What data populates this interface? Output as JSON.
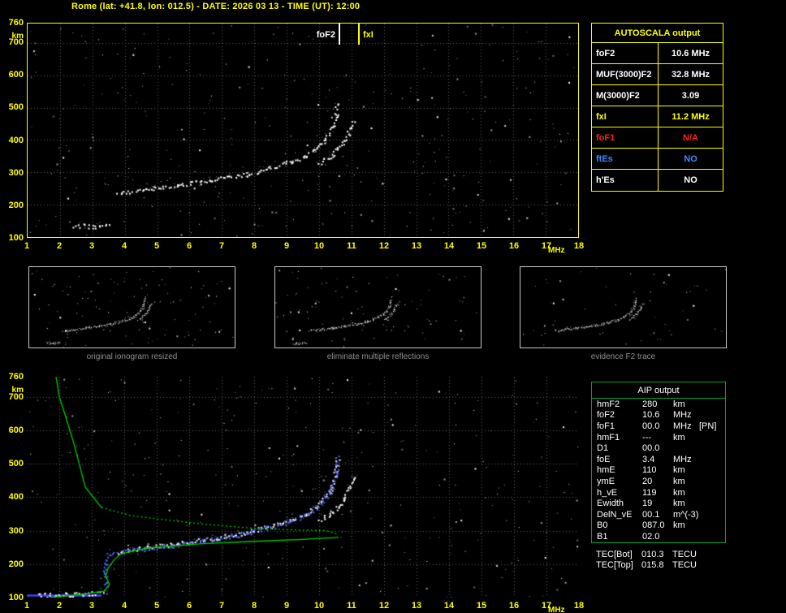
{
  "title": "Rome (lat: +41.8, lon: 012.5) - DATE: 2026 03 13 - TIME (UT): 12:00",
  "colors": {
    "accent_yellow": "#ffff00",
    "status_red": "#ff2222",
    "status_blue": "#3d8bff",
    "profile_green": "#00cc00",
    "restored_blue": "#5066ff"
  },
  "autoscala_table": {
    "title": "AUTOSCALA output",
    "rows": [
      {
        "label": "foF2",
        "value": "10.6 MHz",
        "color": "#ffffff"
      },
      {
        "label": "MUF(3000)F2",
        "value": "32.8 MHz",
        "color": "#ffffff"
      },
      {
        "label": "M(3000)F2",
        "value": "3.09",
        "color": "#ffffff"
      },
      {
        "label": "fxI",
        "value": "11.2 MHz",
        "color": "#ffff00"
      },
      {
        "label": "foF1",
        "value": "N/A",
        "color": "#ff2222"
      },
      {
        "label": "ftEs",
        "value": "NO",
        "color": "#3d8bff"
      },
      {
        "label": "h'Es",
        "value": "NO",
        "color": "#ffffff"
      }
    ]
  },
  "thumbnails": [
    {
      "caption": "original ionogram resized"
    },
    {
      "caption": "eliminate multiple reflections"
    },
    {
      "caption": "evidence F2 trace"
    }
  ],
  "aip_table": {
    "title": "AIP output",
    "rows": [
      {
        "label": "hmF2",
        "value": "280",
        "unit": "km",
        "note": ""
      },
      {
        "label": "foF2",
        "value": "10.6",
        "unit": "MHz",
        "note": ""
      },
      {
        "label": "foF1",
        "value": "00.0",
        "unit": "MHz",
        "note": "[PN]"
      },
      {
        "label": "hmF1",
        "value": "---",
        "unit": "km",
        "note": ""
      },
      {
        "label": "D1",
        "value": "00.0",
        "unit": "",
        "note": ""
      },
      {
        "label": "foE",
        "value": "3.4",
        "unit": "MHz",
        "note": ""
      },
      {
        "label": "hmE",
        "value": "110",
        "unit": "km",
        "note": ""
      },
      {
        "label": "ymE",
        "value": "20",
        "unit": "km",
        "note": ""
      },
      {
        "label": "h_vE",
        "value": "119",
        "unit": "km",
        "note": ""
      },
      {
        "label": "Ewidth",
        "value": "19",
        "unit": "km",
        "note": ""
      },
      {
        "label": "DelN_vE",
        "value": "00.1",
        "unit": "m^(-3)",
        "note": ""
      },
      {
        "label": "B0",
        "value": "087.0",
        "unit": "km",
        "note": ""
      },
      {
        "label": "B1",
        "value": "02.0",
        "unit": "",
        "note": ""
      }
    ],
    "extra_rows": [
      {
        "label": "TEC[Bot]",
        "value": "010.3",
        "unit": "TECU"
      },
      {
        "label": "TEC[Top]",
        "value": "015.8",
        "unit": "TECU"
      }
    ]
  },
  "chart_data": [
    {
      "id": "main_ionogram",
      "type": "scatter",
      "title": "scaled ionogram",
      "xlabel": "frequency",
      "x_unit": "MHz",
      "ylabel": "virtual height",
      "y_unit": "km",
      "xlim": [
        1,
        18
      ],
      "ylim": [
        100,
        760
      ],
      "x_ticks": [
        1,
        2,
        3,
        4,
        5,
        6,
        7,
        8,
        9,
        10,
        11,
        12,
        13,
        14,
        15,
        16,
        17,
        18
      ],
      "y_ticks": [
        760,
        700,
        600,
        500,
        400,
        300,
        200,
        100
      ],
      "grid": true,
      "markers": [
        {
          "label": "foF2",
          "x": 10.6,
          "color": "#ffffff",
          "side": "left"
        },
        {
          "label": "fxI",
          "x": 11.2,
          "color": "#ffff00",
          "side": "right"
        }
      ],
      "series": [
        {
          "name": "e-layer-trace",
          "color": "#ffffff",
          "style": "dots",
          "points": [
            [
              2.45,
              138
            ],
            [
              3.0,
              134
            ],
            [
              3.5,
              140
            ]
          ]
        },
        {
          "name": "f2-ordinary-trace",
          "color": "#ffffff",
          "style": "dots",
          "points": [
            [
              3.8,
              237
            ],
            [
              4.7,
              250
            ],
            [
              5.7,
              262
            ],
            [
              6.7,
              277
            ],
            [
              7.7,
              294
            ],
            [
              8.4,
              312
            ],
            [
              9.1,
              332
            ],
            [
              9.6,
              352
            ],
            [
              9.9,
              374
            ],
            [
              10.2,
              402
            ],
            [
              10.4,
              436
            ],
            [
              10.5,
              474
            ],
            [
              10.55,
              512
            ]
          ]
        },
        {
          "name": "f2-extraordinary-trace",
          "color": "#ffffff",
          "style": "dots",
          "points": [
            [
              10.0,
              330
            ],
            [
              10.3,
              350
            ],
            [
              10.6,
              375
            ],
            [
              10.8,
              405
            ],
            [
              10.95,
              435
            ],
            [
              11.05,
              462
            ]
          ]
        }
      ]
    },
    {
      "id": "profile_ionogram",
      "type": "scatter",
      "title": "ionogram with restored trace and electron density profile",
      "xlabel": "frequency",
      "x_unit": "MHz",
      "ylabel": "height",
      "y_unit": "km",
      "xlim": [
        1,
        18
      ],
      "ylim": [
        100,
        760
      ],
      "x_ticks": [
        1,
        2,
        3,
        4,
        5,
        6,
        7,
        8,
        9,
        10,
        11,
        12,
        13,
        14,
        15,
        16,
        17,
        18
      ],
      "y_ticks": [
        760,
        700,
        600,
        500,
        400,
        300,
        200,
        100
      ],
      "grid": true,
      "markers": [],
      "series": [
        {
          "name": "e-region-echo",
          "color": "#4242ff",
          "style": "thick",
          "points": [
            [
              1.0,
              106
            ],
            [
              3.3,
              106
            ]
          ]
        },
        {
          "name": "e-layer-trace",
          "color": "#ffffff",
          "style": "dots",
          "points": [
            [
              1.3,
              108
            ],
            [
              2.4,
              110
            ],
            [
              3.3,
              116
            ]
          ]
        },
        {
          "name": "f2-ordinary-trace",
          "color": "#ffffff",
          "style": "dots",
          "points": [
            [
              3.8,
              237
            ],
            [
              4.7,
              250
            ],
            [
              5.7,
              262
            ],
            [
              6.7,
              277
            ],
            [
              7.7,
              294
            ],
            [
              8.4,
              312
            ],
            [
              9.1,
              332
            ],
            [
              9.6,
              352
            ],
            [
              9.9,
              374
            ],
            [
              10.2,
              402
            ],
            [
              10.4,
              436
            ],
            [
              10.5,
              474
            ],
            [
              10.55,
              512
            ]
          ]
        },
        {
          "name": "f2-extraordinary-trace",
          "color": "#ffffff",
          "style": "dots",
          "points": [
            [
              10.0,
              330
            ],
            [
              10.3,
              350
            ],
            [
              10.6,
              375
            ],
            [
              10.8,
              405
            ],
            [
              10.95,
              435
            ],
            [
              11.05,
              462
            ]
          ]
        },
        {
          "name": "restored-trace-hook",
          "color": "#5066ff",
          "style": "dots",
          "points": [
            [
              3.45,
              118
            ],
            [
              3.42,
              145
            ],
            [
              3.4,
              175
            ],
            [
              3.42,
              205
            ],
            [
              3.45,
              232
            ]
          ]
        },
        {
          "name": "restored-trace",
          "color": "#5066ff",
          "style": "dots",
          "points": [
            [
              3.5,
              233
            ],
            [
              4.7,
              247
            ],
            [
              5.7,
              259
            ],
            [
              6.7,
              274
            ],
            [
              7.7,
              291
            ],
            [
              8.4,
              309
            ],
            [
              9.1,
              329
            ],
            [
              9.6,
              349
            ],
            [
              9.9,
              371
            ],
            [
              10.2,
              399
            ],
            [
              10.4,
              433
            ],
            [
              10.5,
              471
            ],
            [
              10.56,
              520
            ]
          ]
        },
        {
          "name": "density-profile-topside",
          "color": "#00cc00",
          "style": "line",
          "points": [
            [
              1.9,
              760
            ],
            [
              2.0,
              700
            ],
            [
              2.2,
              640
            ],
            [
              2.45,
              560
            ],
            [
              2.8,
              430
            ],
            [
              3.3,
              369
            ]
          ]
        },
        {
          "name": "density-profile-asymptote",
          "color": "#00cc00",
          "style": "line",
          "dash": [
            2,
            3
          ],
          "points": [
            [
              3.3,
              369
            ],
            [
              4.2,
              345
            ],
            [
              5.2,
              333
            ],
            [
              6.4,
              320
            ],
            [
              7.7,
              309
            ],
            [
              9.0,
              303
            ],
            [
              10.2,
              300
            ],
            [
              10.55,
              290
            ]
          ]
        },
        {
          "name": "density-profile-bottomside",
          "color": "#00cc00",
          "style": "line",
          "points": [
            [
              10.6,
              280
            ],
            [
              9.5,
              274
            ],
            [
              8.0,
              268
            ],
            [
              6.4,
              261
            ],
            [
              4.7,
              248
            ],
            [
              3.9,
              231
            ],
            [
              3.68,
              212
            ],
            [
              3.5,
              187
            ],
            [
              3.43,
              163
            ],
            [
              3.55,
              139
            ],
            [
              3.38,
              119
            ],
            [
              2.7,
              110
            ],
            [
              1.7,
              100
            ]
          ]
        }
      ]
    }
  ]
}
